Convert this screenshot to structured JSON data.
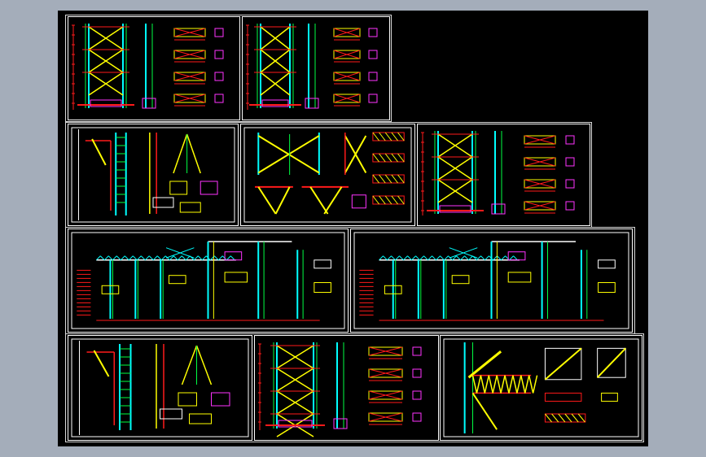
{
  "colors": {
    "background": "#a4adba",
    "canvas": "#000000",
    "frame": "#ffffff",
    "red": "#ff1a1a",
    "yellow": "#ffff00",
    "green": "#00ff44",
    "cyan": "#00ffff",
    "magenta": "#ff33ff",
    "white": "#ffffff"
  },
  "sheets": [
    {
      "id": "sheet-1",
      "type": "column-elevation"
    },
    {
      "id": "sheet-2",
      "type": "column-elevation"
    },
    {
      "id": "sheet-3",
      "type": "column-detail"
    },
    {
      "id": "sheet-4",
      "type": "bracing-detail"
    },
    {
      "id": "sheet-5",
      "type": "column-elevation"
    },
    {
      "id": "sheet-6",
      "type": "frame-section"
    },
    {
      "id": "sheet-7",
      "type": "frame-section"
    },
    {
      "id": "sheet-8",
      "type": "column-detail"
    },
    {
      "id": "sheet-9",
      "type": "column-elevation"
    },
    {
      "id": "sheet-10",
      "type": "truss-detail"
    }
  ]
}
